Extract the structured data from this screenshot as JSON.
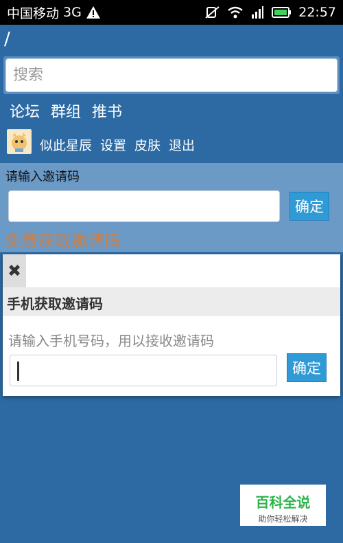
{
  "status_bar": {
    "carrier": "中国移动",
    "network": "3G",
    "time": "22:57",
    "icons": [
      "warning-icon",
      "mute-icon",
      "wifi-icon",
      "signal-icon",
      "battery-icon"
    ]
  },
  "breadcrumb": "/",
  "search": {
    "placeholder": "搜索"
  },
  "nav": {
    "items": [
      "论坛",
      "群组",
      "推书"
    ]
  },
  "user": {
    "avatar_icon": "avatar-icon",
    "links": [
      "似此星辰",
      "设置",
      "皮肤",
      "退出"
    ]
  },
  "invite": {
    "title": "请输入邀请码",
    "input_value": "",
    "confirm_label": "确定",
    "free_link": "免费获取邀请码"
  },
  "modal": {
    "close_icon": "close-icon",
    "title": "手机获取邀请码",
    "hint": "请输入手机号码，用以接收邀请码",
    "input_value": "",
    "confirm_label": "确定"
  },
  "watermark": {
    "title": "百科全说",
    "subtitle": "助你轻松解决"
  },
  "colors": {
    "background": "#2d6aa3",
    "panel": "#6b9ac7",
    "button": "#2f9ad6",
    "link_orange": "#c8804a",
    "watermark_green": "#2db34a"
  }
}
